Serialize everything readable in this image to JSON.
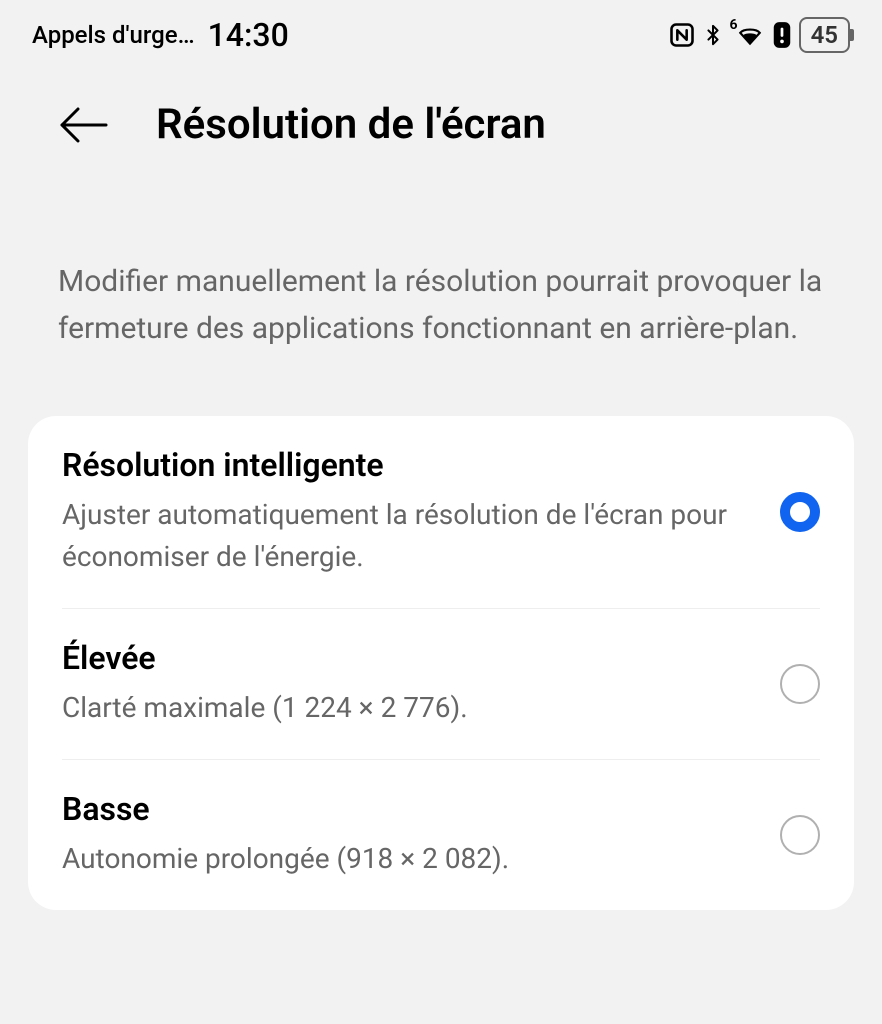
{
  "statusBar": {
    "carrier": "Appels d'urge…",
    "time": "14:30",
    "battery": "45",
    "wifiBand": "6"
  },
  "header": {
    "title": "Résolution de l'écran"
  },
  "description": "Modifier manuellement la résolution pourrait provoquer la fermeture des applications fonctionnant en arrière-plan.",
  "options": [
    {
      "title": "Résolution intelligente",
      "subtitle": "Ajuster automatiquement la résolution de l'écran pour économiser de l'énergie.",
      "selected": true
    },
    {
      "title": "Élevée",
      "subtitle": "Clarté maximale (1 224 × 2 776).",
      "selected": false
    },
    {
      "title": "Basse",
      "subtitle": "Autonomie prolongée (918 × 2 082).",
      "selected": false
    }
  ]
}
